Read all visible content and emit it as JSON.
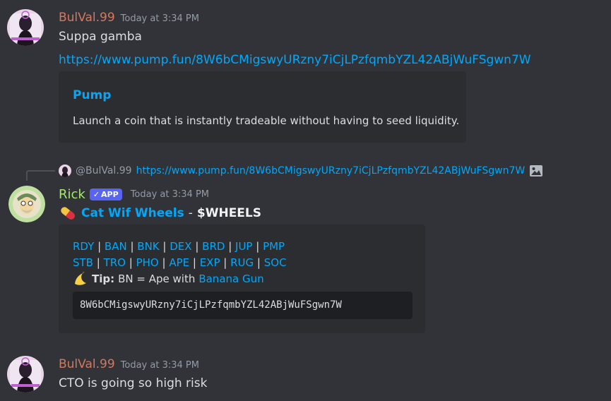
{
  "messages": [
    {
      "author": "BulVal.99",
      "author_color": "#d4785f",
      "timestamp": "Today at 3:34 PM",
      "text": "Suppa gamba",
      "link": "https://www.pump.fun/8W6bCMigswyURzny7iCjLPzfqmbYZL42ABjWuFSgwn7W",
      "embed": {
        "title": "Pump",
        "description": "Launch a coin that is instantly tradeable without having to seed liquidity."
      }
    },
    {
      "reply": {
        "author": "@BulVal.99",
        "link": "https://www.pump.fun/8W6bCMigswyURzny7iCjLPzfqmbYZL42ABjWuFSgwn7W"
      },
      "author": "Rick",
      "author_color": "#a4e86b",
      "badge": "APP",
      "timestamp": "Today at 3:34 PM",
      "token_name": "Cat Wif Wheels",
      "token_sep": "-",
      "ticker": "$WHEELS",
      "links_row1": [
        "RDY",
        "BAN",
        "BNK",
        "DEX",
        "BRD",
        "JUP",
        "PMP"
      ],
      "links_row2": [
        "STB",
        "TRO",
        "PHO",
        "APE",
        "EXP",
        "RUG",
        "SOC"
      ],
      "tip_label": "Tip:",
      "tip_text": "BN = Ape with",
      "tip_link": "Banana Gun",
      "address": "8W6bCMigswyURzny7iCjLPzfqmbYZL42ABjWuFSgwn7W"
    },
    {
      "author": "BulVal.99",
      "author_color": "#d4785f",
      "timestamp": "Today at 3:34 PM",
      "text": "CTO is going so high risk"
    }
  ],
  "colors": {
    "background": "#313338",
    "embed_bg": "#2b2d31",
    "link": "#00a8fc",
    "badge": "#5865f2"
  }
}
